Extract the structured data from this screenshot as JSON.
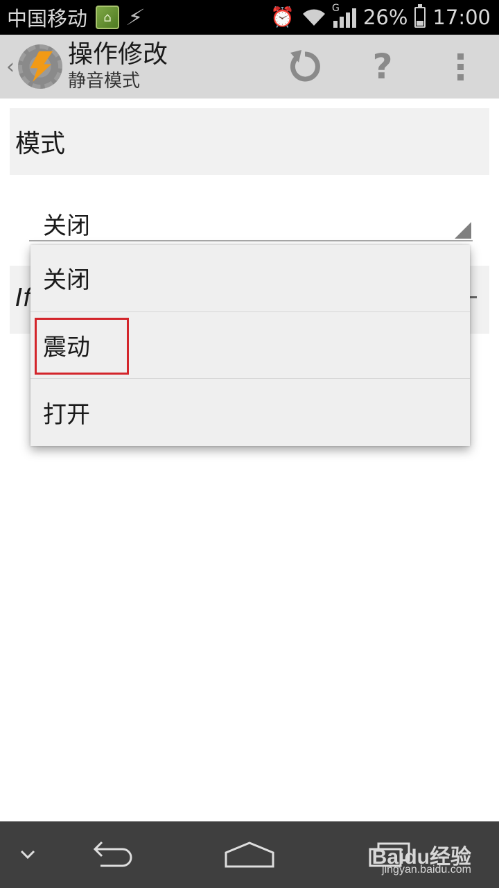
{
  "status_bar": {
    "carrier": "中国移动",
    "battery_percent": "26%",
    "time": "17:00",
    "network_type": "G",
    "icons": [
      "notification-app-icon",
      "lightning-icon",
      "alarm-icon",
      "wifi-icon",
      "signal-icon",
      "battery-icon"
    ],
    "battery_level": 0.26
  },
  "action_bar": {
    "title": "操作修改",
    "subtitle": "静音模式",
    "actions": [
      "refresh-icon",
      "help-icon",
      "overflow-menu-icon"
    ],
    "help_glyph": "?"
  },
  "section": {
    "header": "模式"
  },
  "spinner": {
    "selected": "关闭"
  },
  "background_row": {
    "label": "If"
  },
  "dropdown": {
    "options": [
      "关闭",
      "震动",
      "打开"
    ],
    "highlighted_index": 1
  },
  "nav_bar": {
    "buttons": [
      "hide-keyboard-chevron-icon",
      "back-icon",
      "home-icon",
      "recent-apps-icon"
    ],
    "watermark": "Baidu经验",
    "watermark_url": "jingyan.baidu.com"
  },
  "colors": {
    "status_bar_bg": "#000000",
    "action_bar_bg": "#d8d8d8",
    "section_bg": "#f1f1f1",
    "dropdown_bg": "#efefef",
    "highlight": "#d3252b",
    "nav_bar_bg": "#3f3f3f",
    "app_logo_accent": "#f19a16"
  }
}
